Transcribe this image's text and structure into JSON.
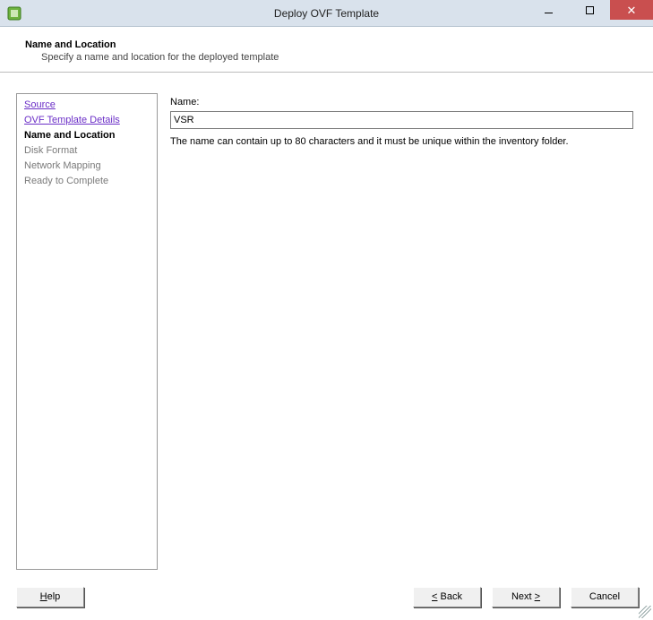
{
  "window": {
    "title": "Deploy OVF Template"
  },
  "header": {
    "title": "Name and Location",
    "subtitle": "Specify a name and location for the deployed template"
  },
  "sidebar": {
    "items": [
      {
        "label": "Source",
        "state": "link"
      },
      {
        "label": "OVF Template Details",
        "state": "link"
      },
      {
        "label": "Name and Location",
        "state": "current"
      },
      {
        "label": "Disk Format",
        "state": "disabled"
      },
      {
        "label": "Network Mapping",
        "state": "disabled"
      },
      {
        "label": "Ready to Complete",
        "state": "disabled"
      }
    ]
  },
  "form": {
    "name_label": "Name:",
    "name_value": "VSR",
    "hint": "The name can contain up to 80 characters and it must be unique within the inventory folder."
  },
  "buttons": {
    "help": "Help",
    "back_prefix": "<",
    "back_text": " Back",
    "next_text": "Next ",
    "next_suffix": ">",
    "cancel": "Cancel"
  }
}
